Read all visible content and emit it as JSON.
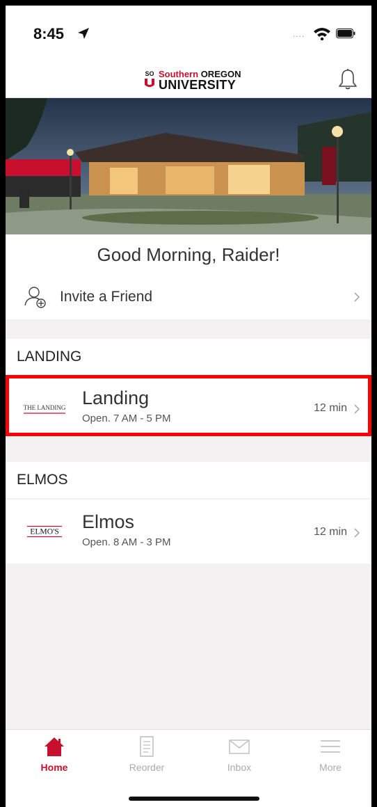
{
  "status": {
    "time": "8:45"
  },
  "brand": {
    "line1a": "Southern",
    "line1b": "OREGON",
    "line2": "UNIVERSITY",
    "mark": "SO"
  },
  "greeting": "Good Morning, Raider!",
  "invite": {
    "label": "Invite a Friend"
  },
  "sections": [
    {
      "title": "LANDING",
      "store": {
        "logo_text": "THE LANDING",
        "name": "Landing",
        "hours": "Open. 7 AM - 5 PM",
        "wait": "12 min"
      }
    },
    {
      "title": "ELMOS",
      "store": {
        "logo_text": "ELMO'S",
        "name": "Elmos",
        "hours": "Open. 8 AM - 3 PM",
        "wait": "12 min"
      }
    }
  ],
  "tabs": [
    {
      "label": "Home",
      "icon": "home-icon",
      "active": true
    },
    {
      "label": "Reorder",
      "icon": "receipt-icon",
      "active": false
    },
    {
      "label": "Inbox",
      "icon": "envelope-icon",
      "active": false
    },
    {
      "label": "More",
      "icon": "menu-icon",
      "active": false
    }
  ],
  "colors": {
    "brand_red": "#c8102e",
    "highlight": "#ff0000",
    "background": "#f3f1f1"
  }
}
